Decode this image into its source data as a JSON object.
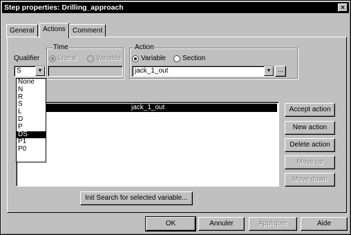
{
  "window": {
    "title": "Step properties: Drilling_approach",
    "close_glyph": "×"
  },
  "tabs": [
    "General",
    "Actions",
    "Comment"
  ],
  "qualifier": {
    "label": "Qualifier",
    "value": "S",
    "options": [
      "None",
      "N",
      "R",
      "S",
      "L",
      "D",
      "P",
      "DS",
      "P1",
      "P0"
    ],
    "highlighted": "DS"
  },
  "time": {
    "group_label": "Time",
    "literal_label": "Literal",
    "variable_label": "Variable",
    "value": ""
  },
  "action": {
    "group_label": "Action",
    "variable_label": "Variable",
    "section_label": "Section",
    "selected_type": "Variable",
    "value": "jack_1_out",
    "browse_label": "..."
  },
  "actions_list": {
    "rows": [
      "jack_1_out"
    ],
    "selected_row": "jack_1_out"
  },
  "side_buttons": {
    "accept": "Accept action",
    "new": "New action",
    "delete": "Delete action",
    "move_up": "Move up",
    "move_down": "Move down"
  },
  "init_search_label": "Init Search for selected variable...",
  "footer": {
    "ok": "OK",
    "cancel": "Annuler",
    "apply": "Appliquer",
    "help": "Aide"
  }
}
